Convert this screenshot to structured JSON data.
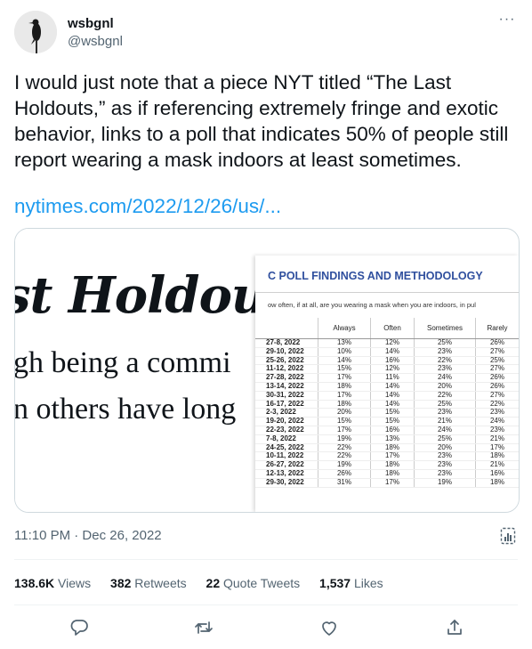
{
  "author": {
    "name": "wsbgnl",
    "handle": "@wsbgnl"
  },
  "menu": {
    "more_icon": "more-horizontal-icon",
    "more_label": "···"
  },
  "tweet": {
    "text": "I would just note that a piece NYT titled “The Last Holdouts,” as if referencing extremely fringe and exotic behavior, links to a poll that indicates 50% of people still report wearing a mask indoors at least sometimes.",
    "link": "nytimes.com/2022/12/26/us/..."
  },
  "card": {
    "headline": "st Holdouts",
    "line1": "gh being a commi",
    "line2": "n others have long",
    "poll_title": "C POLL FINDINGS AND METHODOLOGY",
    "poll_question": "ow often, if at all, are you wearing a mask when you are indoors, in pul",
    "columns": [
      "",
      "Always",
      "Often",
      "Sometimes",
      "Rarely"
    ],
    "rows": [
      [
        "27-8, 2022",
        "13%",
        "12%",
        "25%",
        "26%"
      ],
      [
        "29-10, 2022",
        "10%",
        "14%",
        "23%",
        "27%"
      ],
      [
        "25-26, 2022",
        "14%",
        "16%",
        "22%",
        "25%"
      ],
      [
        "11-12, 2022",
        "15%",
        "12%",
        "23%",
        "27%"
      ],
      [
        "27-28, 2022",
        "17%",
        "11%",
        "24%",
        "26%"
      ],
      [
        "13-14, 2022",
        "18%",
        "14%",
        "20%",
        "26%"
      ],
      [
        "30-31, 2022",
        "17%",
        "14%",
        "22%",
        "27%"
      ],
      [
        "16-17, 2022",
        "18%",
        "14%",
        "25%",
        "22%"
      ],
      [
        "2-3, 2022",
        "20%",
        "15%",
        "23%",
        "23%"
      ],
      [
        "19-20, 2022",
        "15%",
        "15%",
        "21%",
        "24%"
      ],
      [
        "22-23, 2022",
        "17%",
        "16%",
        "24%",
        "23%"
      ],
      [
        "7-8, 2022",
        "19%",
        "13%",
        "25%",
        "21%"
      ],
      [
        "24-25, 2022",
        "22%",
        "18%",
        "20%",
        "17%"
      ],
      [
        "10-11, 2022",
        "22%",
        "17%",
        "23%",
        "18%"
      ],
      [
        "26-27, 2022",
        "19%",
        "18%",
        "23%",
        "21%"
      ],
      [
        "12-13, 2022",
        "26%",
        "18%",
        "23%",
        "16%"
      ],
      [
        "29-30, 2022",
        "31%",
        "17%",
        "19%",
        "18%"
      ]
    ]
  },
  "meta": {
    "timestamp": "11:10 PM · Dec 26, 2022",
    "analytics_icon": "analytics-icon"
  },
  "stats": {
    "views_count": "138.6K",
    "views_label": "Views",
    "retweets_count": "382",
    "retweets_label": "Retweets",
    "quotes_count": "22",
    "quotes_label": "Quote Tweets",
    "likes_count": "1,537",
    "likes_label": "Likes"
  },
  "actions": [
    "reply-icon",
    "retweet-icon",
    "like-icon",
    "share-icon"
  ],
  "colors": {
    "link": "#1d9bf0",
    "muted": "#536471",
    "text": "#0f1419",
    "poll_title": "#2f4f9e"
  }
}
